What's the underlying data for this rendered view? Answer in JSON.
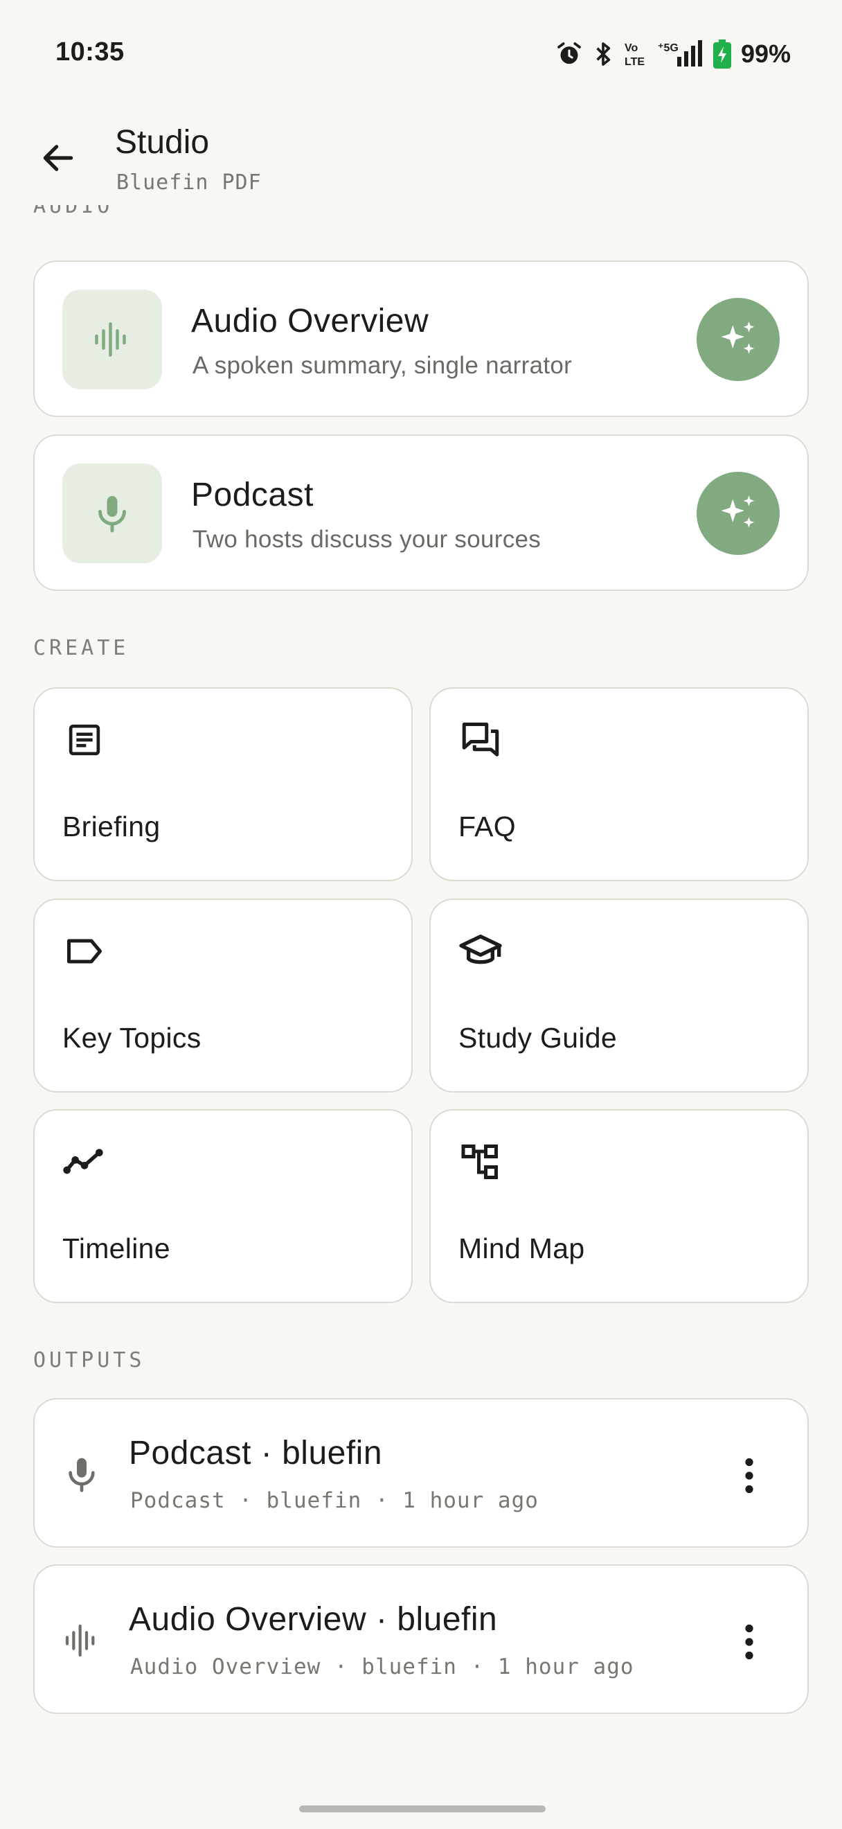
{
  "status_bar": {
    "time": "10:35",
    "battery": "99%",
    "icons": [
      "alarm-icon",
      "bluetooth-icon",
      "volte-icon",
      "5g-signal-icon",
      "battery-charging-icon"
    ]
  },
  "app_bar": {
    "title": "Studio",
    "subtitle": "Bluefin PDF",
    "back_icon": "arrow-left-icon"
  },
  "sections": {
    "audio": "AUDIO",
    "create": "CREATE",
    "outputs": "OUTPUTS"
  },
  "audio_cards": [
    {
      "title": "Audio Overview",
      "subtitle": "A spoken summary, single narrator",
      "icon": "waveform-icon",
      "action_icon": "sparkles-icon"
    },
    {
      "title": "Podcast",
      "subtitle": "Two hosts discuss your sources",
      "icon": "microphone-icon",
      "action_icon": "sparkles-icon"
    }
  ],
  "create_tiles": [
    {
      "label": "Briefing",
      "icon": "article-icon"
    },
    {
      "label": "FAQ",
      "icon": "forum-icon"
    },
    {
      "label": "Key Topics",
      "icon": "label-icon"
    },
    {
      "label": "Study Guide",
      "icon": "school-icon"
    },
    {
      "label": "Timeline",
      "icon": "timeline-icon"
    },
    {
      "label": "Mind Map",
      "icon": "account-tree-icon"
    }
  ],
  "outputs": [
    {
      "title": "Podcast · bluefin",
      "meta": "Podcast · bluefin · 1 hour ago",
      "icon": "microphone-icon"
    },
    {
      "title": "Audio Overview · bluefin",
      "meta": "Audio Overview · bluefin · 1 hour ago",
      "icon": "waveform-icon"
    }
  ],
  "colors": {
    "background": "#f8f7f3",
    "accent_green": "#82aa80",
    "icon_box_bg": "#e6eee4",
    "card_border": "#dcdad3"
  }
}
